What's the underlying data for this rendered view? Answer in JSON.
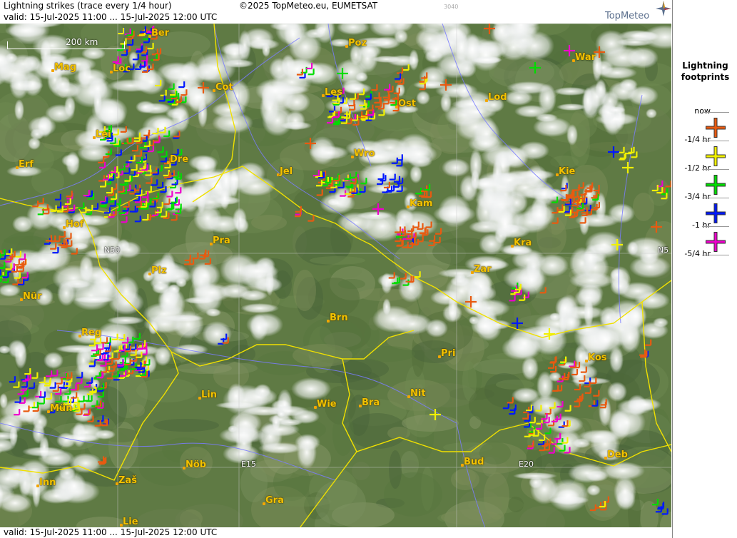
{
  "header": {
    "title": "Lightning strikes (trace every 1/4 hour)",
    "copyright": "©2025 TopMeteo.eu, EUMETSAT",
    "image_number": "3040",
    "valid": "valid:  15-Jul-2025 11:00 ... 15-Jul-2025 12:00 UTC",
    "logo": "TopMeteo"
  },
  "footer": {
    "valid": "valid:  15-Jul-2025 11:00 ... 15-Jul-2025 12:00 UTC"
  },
  "scale": {
    "label": "200 km"
  },
  "legend": {
    "title_line1": "Lightning",
    "title_line2": "footprints",
    "items": [
      {
        "label": "now",
        "color": "#e85a10"
      },
      {
        "label": "-1/4 hr",
        "color": "#f0f000"
      },
      {
        "label": "-1/2 hr",
        "color": "#00dd00"
      },
      {
        "label": "-3/4 hr",
        "color": "#0018ff"
      },
      {
        "label": "-1 hr",
        "color": "#ee00cc"
      },
      {
        "label": "-5/4 hr",
        "color": ""
      }
    ]
  },
  "grid_labels": [
    "N50",
    "N5",
    "E15",
    "E20"
  ],
  "cities": [
    "Ber",
    "Poz",
    "War",
    "Mag",
    "Loc",
    "Cot",
    "Les",
    "Ost",
    "Lod",
    "Lei",
    "Dre",
    "Erf",
    "Jel",
    "Wro",
    "Kie",
    "Kam",
    "Hof",
    "Pra",
    "Kra",
    "Plz",
    "Zar",
    "Nür",
    "Brn",
    "Reg",
    "Pri",
    "Kos",
    "Lin",
    "Mün",
    "Wie",
    "Bra",
    "Nit",
    "Inn",
    "Zaš",
    "Nöb",
    "Bud",
    "Deb",
    "Gra",
    "Lie"
  ],
  "colors": {
    "now": "#e85a10",
    "q1": "#f0f000",
    "q2": "#00dd00",
    "q3": "#0018ff",
    "q4": "#ee00cc",
    "city": "#f3c200",
    "border": "#f0e000",
    "river": "#7070ff"
  }
}
